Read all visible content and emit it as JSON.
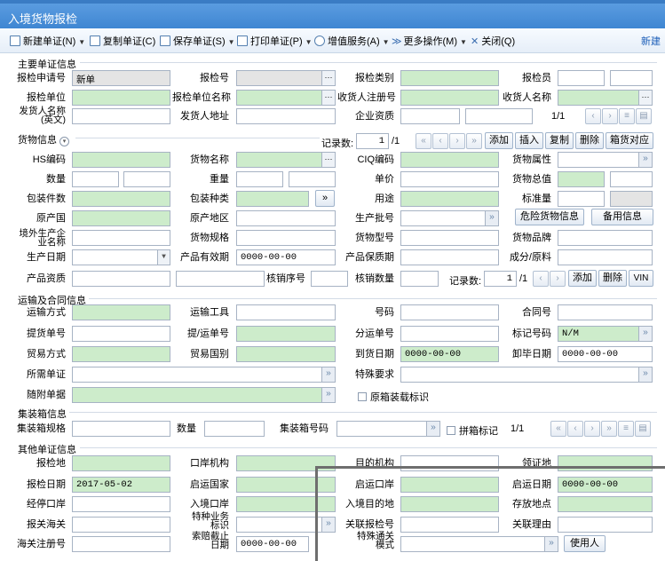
{
  "window": {
    "title": "入境货物报检"
  },
  "toolbar": {
    "new": "新建单证(N)",
    "copy": "复制单证(C)",
    "save": "保存单证(S)",
    "print": "打印单证(P)",
    "value_added": "增值服务(A)",
    "more": "更多操作(M)",
    "close": "关闭(Q)",
    "new_right": "新建"
  },
  "sections": {
    "main": "主要单证信息",
    "goods": "货物信息",
    "transport": "运输及合同信息",
    "container": "集装箱信息",
    "other": "其他单证信息"
  },
  "main": {
    "apply_no_label": "报检申请号",
    "apply_no_value": "新单",
    "insp_no_label": "报检号",
    "insp_type_label": "报检类别",
    "inspector_label": "报检员",
    "unit_label": "报检单位",
    "unit_name_label": "报检单位名称",
    "consignee_reg_label": "收货人注册号",
    "consignee_name_label": "收货人名称",
    "shipper_name_label": "发货人名称(英文)",
    "shipper_addr_label": "发货人地址",
    "qual_label": "企业资质",
    "pager": "1/1"
  },
  "goods": {
    "record_label": "记录数:",
    "record_value": "1",
    "record_total": "/1",
    "add": "添加",
    "insert": "插入",
    "copy": "复制",
    "delete": "删除",
    "box_map": "箱货对应",
    "hs_label": "HS编码",
    "name_label": "货物名称",
    "ciq_label": "CIQ编码",
    "attr_label": "货物属性",
    "qty_label": "数量",
    "weight_label": "重量",
    "price_label": "单价",
    "total_label": "货物总值",
    "pkg_count_label": "包装件数",
    "pkg_type_label": "包装种类",
    "purpose_label": "用途",
    "std_qty_label": "标准量",
    "origin_label": "原产国",
    "origin_area_label": "原产地区",
    "batch_label": "生产批号",
    "danger_btn": "危险货物信息",
    "backup_btn": "备用信息",
    "producer_label": "境外生产企业名称",
    "spec_label": "货物规格",
    "model_label": "货物型号",
    "brand_label": "货物品牌",
    "prod_date_label": "生产日期",
    "valid_label": "产品有效期",
    "valid_value": "0000-00-00",
    "shelf_label": "产品保质期",
    "ingredient_label": "成分/原料",
    "prod_qual_label": "产品资质",
    "writeoff_no_label": "核销序号",
    "writeoff_qty_label": "核销数量",
    "sub_record_label": "记录数:",
    "sub_record_value": "1",
    "sub_record_total": "/1",
    "sub_add": "添加",
    "sub_delete": "删除",
    "vin": "VIN"
  },
  "transport": {
    "mode_label": "运输方式",
    "tool_label": "运输工具",
    "no_label": "号码",
    "contract_label": "合同号",
    "bill_label": "提货单号",
    "bol_label": "提/运单号",
    "sub_bill_label": "分运单号",
    "mark_label": "标记号码",
    "mark_value": "N/M",
    "trade_label": "贸易方式",
    "trade_country_label": "贸易国别",
    "arrive_label": "到货日期",
    "arrive_value": "0000-00-00",
    "unload_label": "卸毕日期",
    "unload_value": "0000-00-00",
    "docs_label": "所需单证",
    "special_label": "特殊要求",
    "attached_label": "随附单据",
    "original_box": "原箱装载标识"
  },
  "container": {
    "spec_label": "集装箱规格",
    "qty_label": "数量",
    "no_label": "集装箱号码",
    "lcl_label": "拼箱标记",
    "pager": "1/1"
  },
  "other": {
    "place_label": "报检地",
    "port_org_label": "口岸机构",
    "dest_org_label": "目的机构",
    "cert_place_label": "领证地",
    "date_label": "报检日期",
    "date_value": "2017-05-02",
    "ship_country_label": "启运国家",
    "ship_port_label": "启运口岸",
    "ship_date_label": "启运日期",
    "ship_date_value": "0000-00-00",
    "via_port_label": "经停口岸",
    "entry_port_label": "入境口岸",
    "entry_dest_label": "入境目的地",
    "storage_label": "存放地点",
    "customs_label": "报关海关",
    "special_biz_label": "特种业务标识",
    "rel_no_label": "关联报检号",
    "rel_reason_label": "关联理由",
    "customs_reg_label": "海关注册号",
    "deadline_label": "索赔截止日期",
    "deadline_value": "0000-00-00",
    "special_clear_label": "特殊通关模式",
    "user_btn": "使用人"
  },
  "colors": {
    "title_bar": "#4a90d9",
    "green_field": "#cdeccb",
    "link": "#1a5db8"
  }
}
